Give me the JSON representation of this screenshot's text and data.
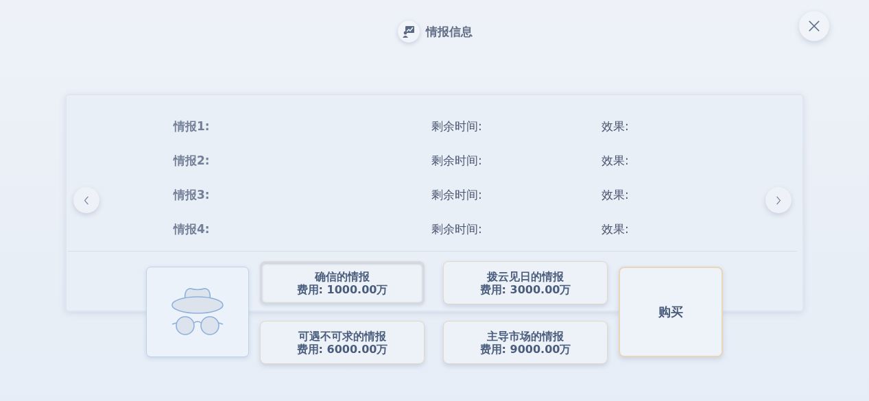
{
  "title": "情报信息",
  "rows": [
    {
      "name": "情报1:",
      "time": "剩余时间:",
      "effect": "效果:"
    },
    {
      "name": "情报2:",
      "time": "剩余时间:",
      "effect": "效果:"
    },
    {
      "name": "情报3:",
      "time": "剩余时间:",
      "effect": "效果:"
    },
    {
      "name": "情报4:",
      "time": "剩余时间:",
      "effect": "效果:"
    }
  ],
  "options": [
    {
      "name": "确信的情报",
      "cost": "费用: 1000.00万",
      "selected": true
    },
    {
      "name": "拨云见日的情报",
      "cost": "费用: 3000.00万",
      "selected": false
    },
    {
      "name": "可遇不可求的情报",
      "cost": "费用: 6000.00万",
      "selected": false
    },
    {
      "name": "主导市场的情报",
      "cost": "费用: 9000.00万",
      "selected": false
    }
  ],
  "buy_button": "购买"
}
